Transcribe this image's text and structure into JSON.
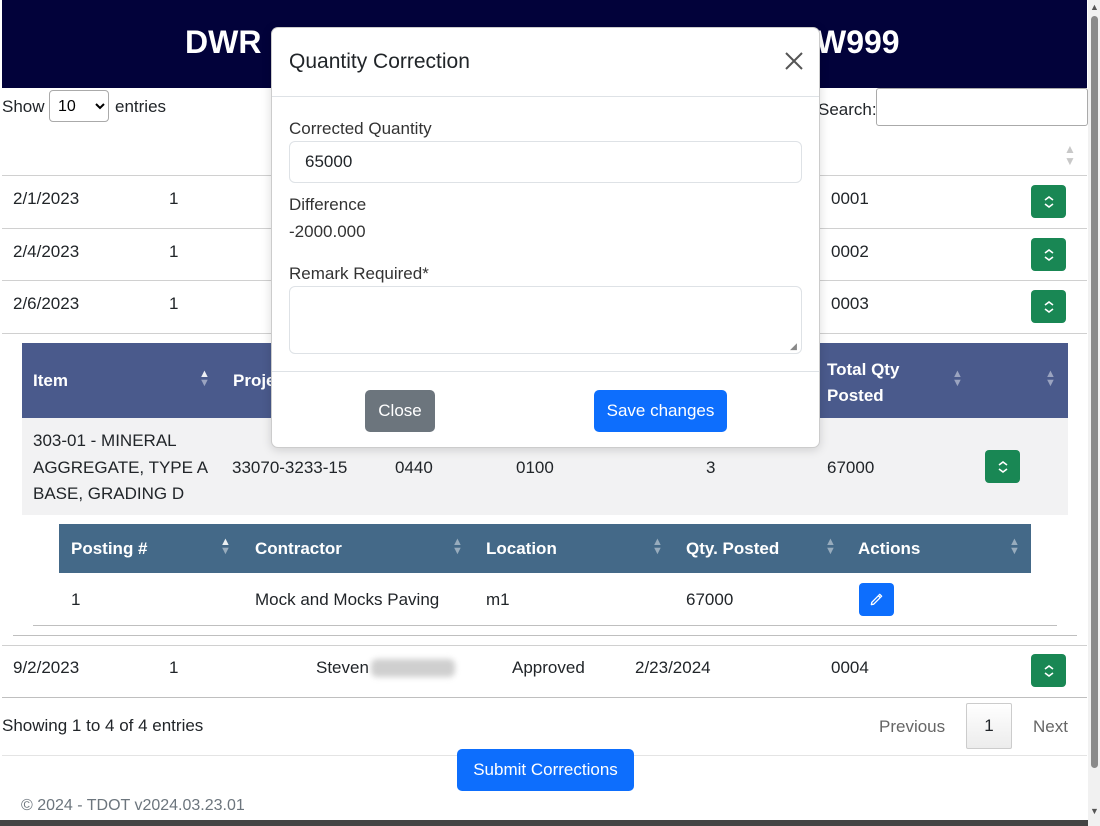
{
  "header": {
    "title_left": "DWR",
    "title_right": "W999"
  },
  "table_controls": {
    "show_label": "Show",
    "length_value": "10",
    "entries_label": "entries",
    "search_label": "Search:"
  },
  "rows": [
    {
      "date": "2/1/2023",
      "num": "1",
      "code": "0001"
    },
    {
      "date": "2/4/2023",
      "num": "1",
      "code": "0002"
    },
    {
      "date": "2/6/2023",
      "num": "1",
      "code": "0003"
    }
  ],
  "inner_table": {
    "headers": {
      "item": "Item",
      "project": "Proje",
      "total_qty": "Total Qty Posted"
    },
    "row": {
      "item": "303-01 - MINERAL AGGREGATE, TYPE A BASE, GRADING D",
      "project": "33070-3233-15",
      "c1": "0440",
      "c2": "0100",
      "c3": "3",
      "total": "67000"
    }
  },
  "posting_table": {
    "headers": {
      "posting": "Posting #",
      "contractor": "Contractor",
      "location": "Location",
      "qty": "Qty. Posted",
      "actions": "Actions"
    },
    "row": {
      "posting": "1",
      "contractor": "Mock and Mocks Paving",
      "location": "m1",
      "qty": "67000"
    }
  },
  "last_row": {
    "date": "9/2/2023",
    "num": "1",
    "name": "Steven",
    "status": "Approved",
    "approved_date": "2/23/2024",
    "code": "0004"
  },
  "footer_table": {
    "info": "Showing 1 to 4 of 4 entries",
    "previous": "Previous",
    "page": "1",
    "next": "Next"
  },
  "submit_label": "Submit Corrections",
  "copyright": "© 2024 - TDOT v2024.03.23.01",
  "modal": {
    "title": "Quantity Correction",
    "corrected_label": "Corrected Quantity",
    "corrected_value": "65000",
    "difference_label": "Difference",
    "difference_value": "-2000.000",
    "remark_label": "Remark Required*",
    "remark_value": "",
    "close_label": "Close",
    "save_label": "Save changes"
  },
  "colors": {
    "header_bg": "#02023a",
    "primary": "#0d6efd",
    "success": "#198754",
    "secondary": "#6c757d",
    "item_head": "#4a5a8c",
    "posting_head": "#446988"
  }
}
